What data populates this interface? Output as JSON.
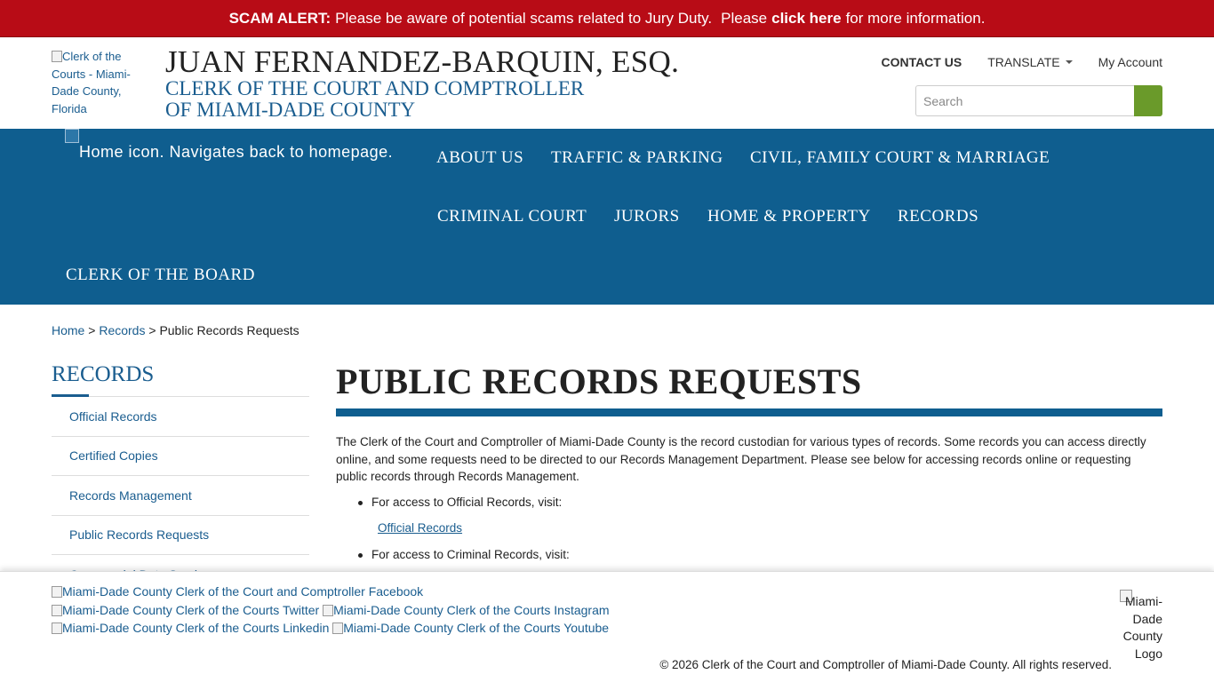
{
  "alert": {
    "label": "SCAM ALERT:",
    "message": "Please be aware of potential scams related to Jury Duty.",
    "prefix": "Please",
    "link_text": "click here",
    "suffix": "for more information."
  },
  "header": {
    "logo_alt": "Clerk of the Courts - Miami-Dade County, Florida",
    "name": "JUAN FERNANDEZ-BARQUIN, ESQ.",
    "subtitle_line1": "CLERK OF THE COURT AND COMPTROLLER",
    "subtitle_line2": "OF MIAMI-DADE COUNTY",
    "contact_us": "CONTACT US",
    "translate": "TRANSLATE",
    "my_account": "My Account",
    "search_placeholder": "Search"
  },
  "nav": {
    "home_alt": "Home icon. Navigates back to homepage.",
    "items": [
      "ABOUT US",
      "TRAFFIC & PARKING",
      "CIVIL, FAMILY COURT & MARRIAGE",
      "CRIMINAL COURT",
      "JURORS",
      "HOME & PROPERTY",
      "RECORDS",
      "CLERK OF THE BOARD"
    ]
  },
  "breadcrumb": {
    "home": "Home",
    "sep": ">",
    "records": "Records",
    "current": "Public Records Requests"
  },
  "sidebar": {
    "title": "RECORDS",
    "items": [
      "Official Records",
      "Certified Copies",
      "Records Management",
      "Public Records Requests",
      "Commercial Data Services"
    ]
  },
  "main": {
    "title": "PUBLIC RECORDS REQUESTS",
    "intro": "The Clerk of the Court and Comptroller of Miami-Dade County is the record custodian for various types of records. Some records you can access directly online, and some requests need to be directed to our Records Management Department. Please see below for accessing records online or requesting public records through Records Management.",
    "bullet1": "For access to Official Records, visit:",
    "bullet1_link": "Official Records",
    "bullet2": "For access to Criminal Records, visit:"
  },
  "footer": {
    "facebook_alt": "Miami-Dade County Clerk of the Court and Comptroller Facebook",
    "twitter_alt": "Miami-Dade County Clerk of the Courts Twitter",
    "instagram_alt": "Miami-Dade County Clerk of the Courts Instagram",
    "linkedin_alt": "Miami-Dade County Clerk of the Courts Linkedin",
    "youtube_alt": "Miami-Dade County Clerk of the Courts Youtube",
    "copyright": "© 2026 Clerk of the Court and Comptroller of Miami-Dade County. All rights reserved.",
    "county_logo_alt": "Miami-Dade County Logo"
  }
}
